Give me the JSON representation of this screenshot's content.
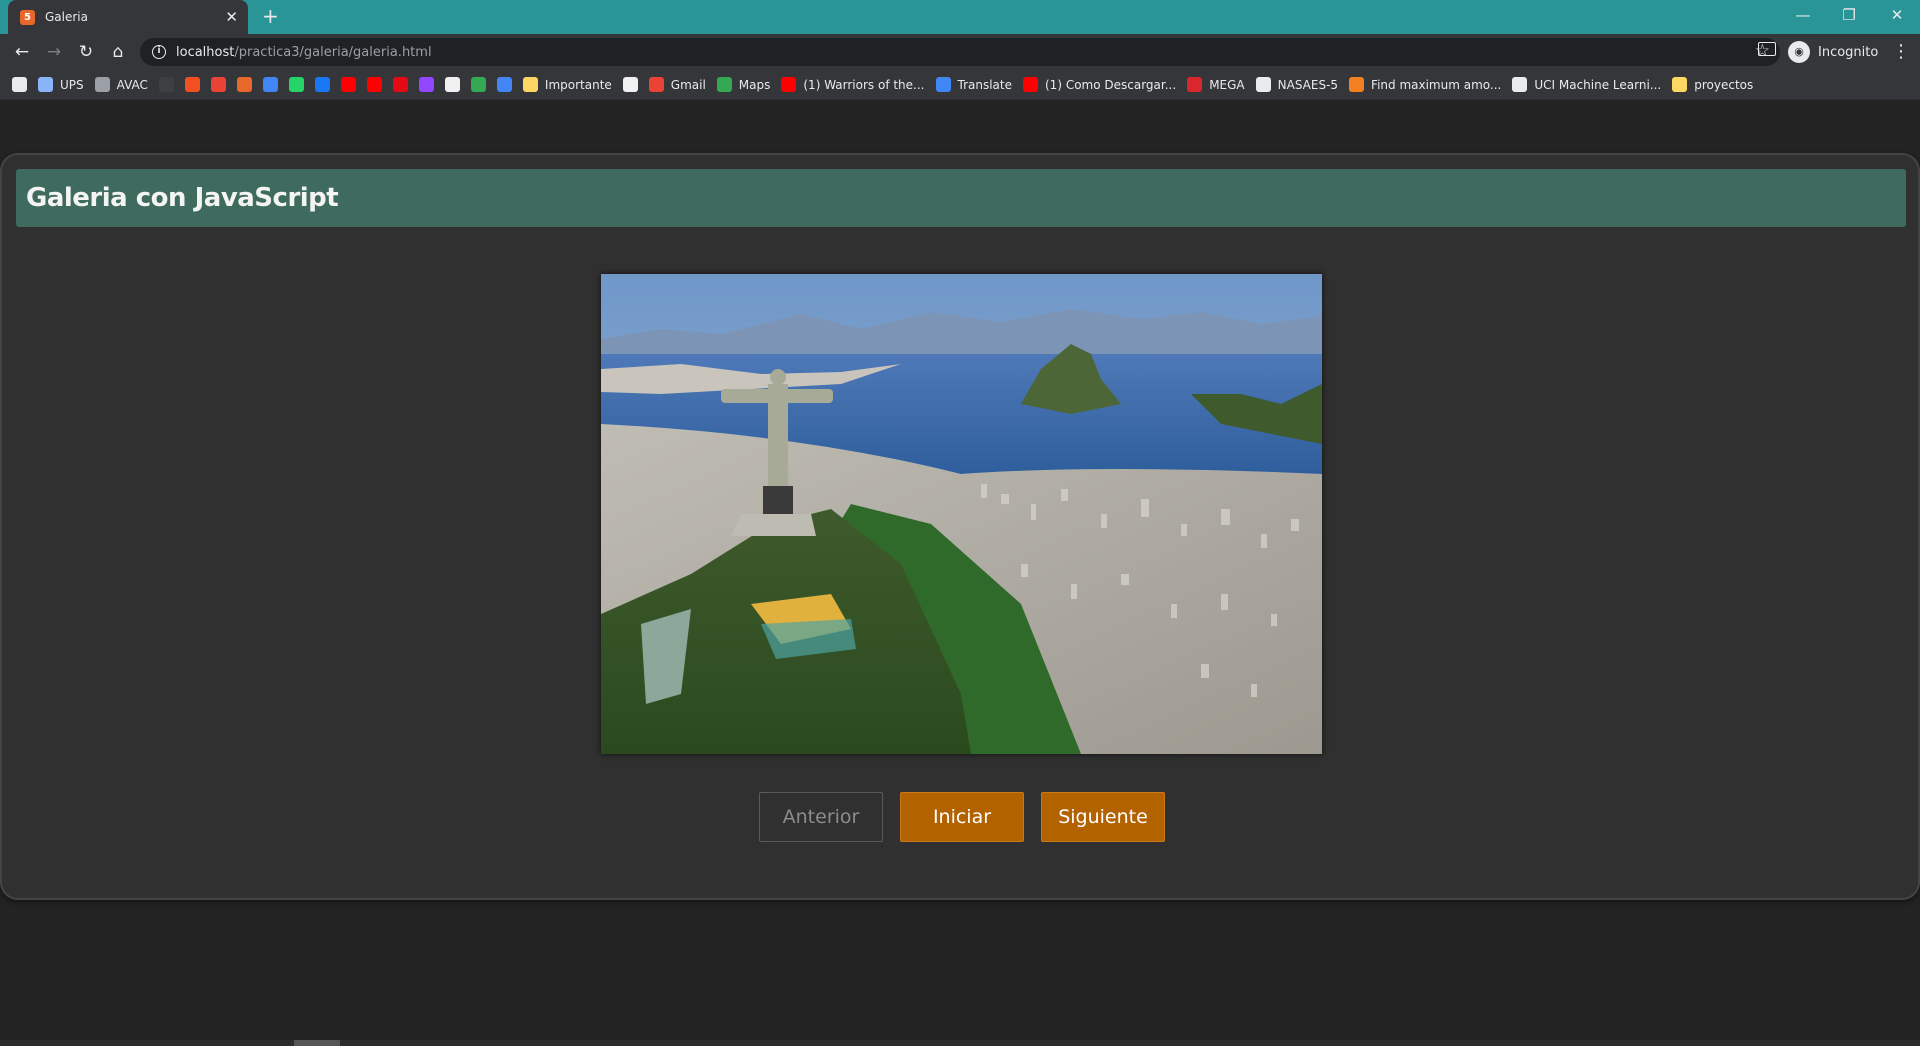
{
  "browser": {
    "tab_title": "Galeria",
    "tab_favicon": "html5-icon",
    "url_host": "localhost",
    "url_path": "/practica3/galeria/galeria.html",
    "profile_label": "Incognito",
    "bookmarks": [
      {
        "label": "",
        "icon": "apps-grid-icon",
        "color": "#e8eaed"
      },
      {
        "label": "UPS",
        "icon": "ups-icon",
        "color": "#8ab4f8"
      },
      {
        "label": "AVAC",
        "icon": "avac-icon",
        "color": "#9aa0a6"
      },
      {
        "label": "",
        "icon": "github-icon",
        "color": "#3c4043"
      },
      {
        "label": "",
        "icon": "microsoft-icon",
        "color": "#f25022"
      },
      {
        "label": "",
        "icon": "gmail-icon",
        "color": "#ea4335"
      },
      {
        "label": "",
        "icon": "office-icon",
        "color": "#e8672a"
      },
      {
        "label": "",
        "icon": "outlook-icon",
        "color": "#4285f4"
      },
      {
        "label": "",
        "icon": "whatsapp-icon",
        "color": "#25d366"
      },
      {
        "label": "",
        "icon": "facebook-icon",
        "color": "#1877f2"
      },
      {
        "label": "",
        "icon": "youtube-icon",
        "color": "#ff0000"
      },
      {
        "label": "",
        "icon": "youtube-music-icon",
        "color": "#ff0000"
      },
      {
        "label": "",
        "icon": "netflix-icon",
        "color": "#e50914"
      },
      {
        "label": "",
        "icon": "twitch-icon",
        "color": "#9146ff"
      },
      {
        "label": "",
        "icon": "amazon-icon",
        "color": "#f0f0f0"
      },
      {
        "label": "",
        "icon": "maps-pin-icon",
        "color": "#34a853"
      },
      {
        "label": "",
        "icon": "translate-icon",
        "color": "#4285f4"
      },
      {
        "label": "Importante",
        "icon": "folder-icon",
        "color": "#fdd663"
      },
      {
        "label": "",
        "icon": "google-icon",
        "color": "#f0f0f0"
      },
      {
        "label": "Gmail",
        "icon": "gmail-icon",
        "color": "#ea4335"
      },
      {
        "label": "Maps",
        "icon": "maps-pin-icon",
        "color": "#34a853"
      },
      {
        "label": "(1) Warriors of the...",
        "icon": "youtube-icon",
        "color": "#ff0000"
      },
      {
        "label": "Translate",
        "icon": "translate-icon",
        "color": "#4285f4"
      },
      {
        "label": "(1) Como Descargar...",
        "icon": "youtube-icon",
        "color": "#ff0000"
      },
      {
        "label": "MEGA",
        "icon": "mega-icon",
        "color": "#d9272e"
      },
      {
        "label": "NASAES-5",
        "icon": "globe-icon",
        "color": "#e8eaed"
      },
      {
        "label": "Find maximum amo...",
        "icon": "stack-icon",
        "color": "#f48024"
      },
      {
        "label": "UCI Machine Learni...",
        "icon": "globe-icon",
        "color": "#e8eaed"
      },
      {
        "label": "proyectos",
        "icon": "folder-icon",
        "color": "#fdd663"
      }
    ]
  },
  "page": {
    "title": "Galeria con JavaScript",
    "image_alt": "Cristo Redentor, Rio de Janeiro",
    "buttons": {
      "prev": "Anterior",
      "start": "Iniciar",
      "next": "Siguiente"
    }
  },
  "colors": {
    "tabstrip": "#2a9596",
    "header": "#3f6a5e",
    "button_accent": "#b36200"
  }
}
